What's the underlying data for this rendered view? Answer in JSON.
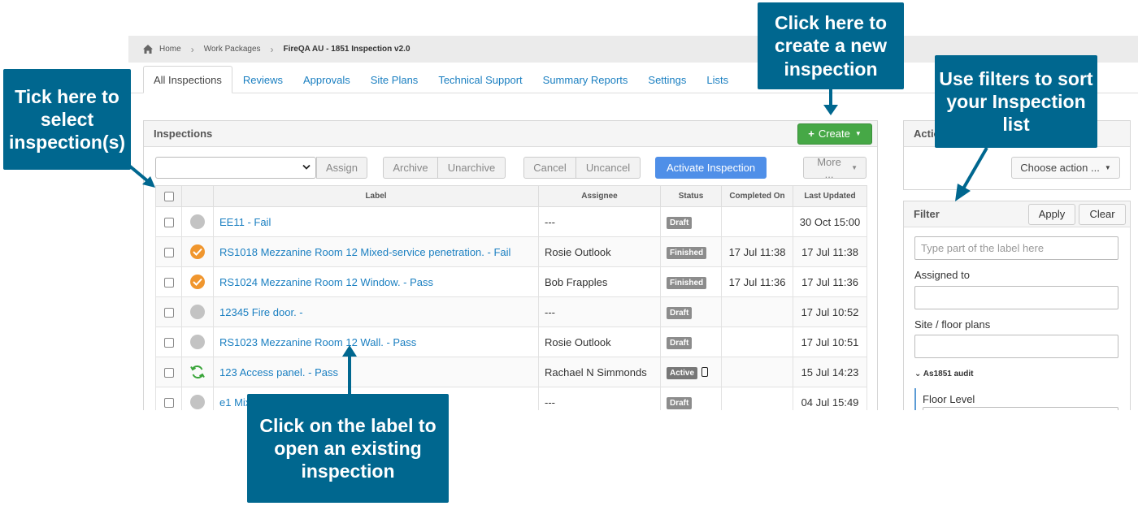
{
  "breadcrumb": {
    "home": "Home",
    "work_packages": "Work Packages",
    "current": "FireQA AU - 1851 Inspection v2.0"
  },
  "tabs": [
    {
      "label": "All Inspections"
    },
    {
      "label": "Reviews"
    },
    {
      "label": "Approvals"
    },
    {
      "label": "Site Plans"
    },
    {
      "label": "Technical Support"
    },
    {
      "label": "Summary Reports"
    },
    {
      "label": "Settings"
    },
    {
      "label": "Lists"
    }
  ],
  "inspections": {
    "title": "Inspections",
    "create_label": "Create",
    "toolbar": {
      "assign": "Assign",
      "archive": "Archive",
      "unarchive": "Unarchive",
      "cancel": "Cancel",
      "uncancel": "Uncancel",
      "activate": "Activate Inspection",
      "more": "More ..."
    },
    "columns": {
      "label": "Label",
      "assignee": "Assignee",
      "status": "Status",
      "completed_on": "Completed On",
      "last_updated": "Last Updated"
    },
    "rows": [
      {
        "label": "EE11 - Fail",
        "assignee": "---",
        "status": "Draft",
        "completed_on": "",
        "last_updated": "30 Oct 15:00",
        "state_icon": "grey-dot-icon"
      },
      {
        "label": "RS1018 Mezzanine Room 12 Mixed-service penetration. - Fail",
        "assignee": "Rosie Outlook",
        "status": "Finished",
        "completed_on": "17 Jul 11:38",
        "last_updated": "17 Jul 11:38",
        "state_icon": "check-circle-icon"
      },
      {
        "label": "RS1024 Mezzanine Room 12 Window. - Pass",
        "assignee": "Bob Frapples",
        "status": "Finished",
        "completed_on": "17 Jul 11:36",
        "last_updated": "17 Jul 11:36",
        "state_icon": "check-circle-icon"
      },
      {
        "label": "12345 Fire door. -",
        "assignee": "---",
        "status": "Draft",
        "completed_on": "",
        "last_updated": "17 Jul 10:52",
        "state_icon": "grey-dot-icon"
      },
      {
        "label": "RS1023 Mezzanine Room 12 Wall. - Pass",
        "assignee": "Rosie Outlook",
        "status": "Draft",
        "completed_on": "",
        "last_updated": "17 Jul 10:51",
        "state_icon": "grey-dot-icon"
      },
      {
        "label": "123 Access panel. - Pass",
        "assignee": "Rachael N Simmonds",
        "status": "Active",
        "completed_on": "",
        "last_updated": "15 Jul 14:23",
        "state_icon": "sync-icon"
      },
      {
        "label": "e1 Mix",
        "assignee": "---",
        "status": "Draft",
        "completed_on": "",
        "last_updated": "04 Jul 15:49",
        "state_icon": "grey-dot-icon"
      }
    ]
  },
  "actions": {
    "title": "Actio",
    "choose_action": "Choose action ..."
  },
  "filter": {
    "title": "Filter",
    "apply": "Apply",
    "clear": "Clear",
    "label_placeholder": "Type part of the label here",
    "assigned_to": "Assigned to",
    "site_floor_plans": "Site / floor plans",
    "section": "As1851 audit",
    "floor_level": "Floor Level"
  },
  "callouts": {
    "select": "Tick here to select inspection(s)",
    "create": "Click here to create a new inspection",
    "filters": "Use filters to sort your Inspection list",
    "label": "Click on the label to open an existing inspection"
  },
  "colors": {
    "callout": "#00678f",
    "link": "#1a7fc1",
    "create": "#46a846",
    "activate": "#4f8fe8",
    "finished_icon": "#f0962e"
  }
}
